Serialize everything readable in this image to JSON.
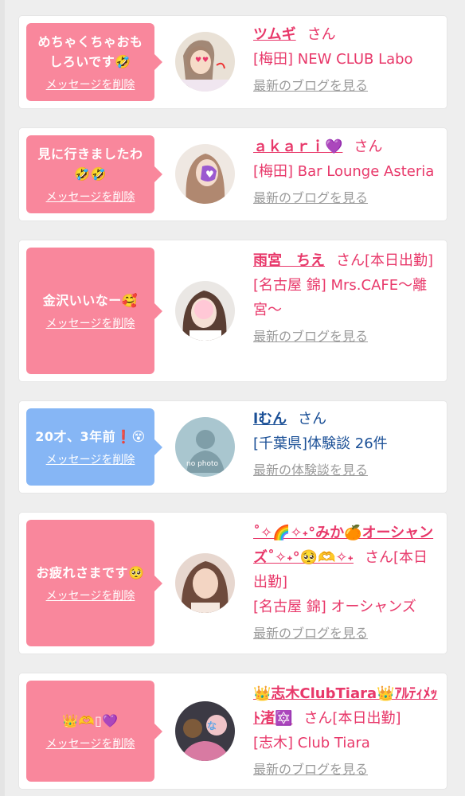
{
  "delete_label": "メッセージを削除",
  "san_label": "さん",
  "entries": [
    {
      "message": "めちゃくちゃおもしろいです🤣",
      "name": "ツムギ",
      "tag": "",
      "shop": "[梅田] NEW CLUB Labo",
      "link": "最新のブログを見る"
    },
    {
      "message": "見に行きましたわ🤣🤣",
      "name": "ａｋａｒｉ💜",
      "tag": "",
      "shop": "[梅田] Bar Lounge Asteria",
      "link": "最新のブログを見る"
    },
    {
      "message": "金沢いいなー🥰",
      "name": "雨宮　ちえ",
      "tag": "[本日出勤]",
      "shop": "[名古屋 錦] Mrs.CAFE～離宮～",
      "link": "最新のブログを見る"
    },
    {
      "message": "20才、3年前❗😵",
      "name": "lむん",
      "tag": "",
      "shop": "[千葉県]体験談 26件",
      "link": "最新の体験談を見る",
      "avatar_text": "no photo"
    },
    {
      "message": "お疲れさまです🥺",
      "name": "˚✧🌈✧˖°みか🍊オーシャンズ˚✧˖°🥺🫶✧˖",
      "tag": "[本日出勤]",
      "shop": "[名古屋 錦] オーシャンズ",
      "link": "最新のブログを見る"
    },
    {
      "message": "👑🫶▯💜",
      "name": "👑志木ClubTiara👑ｱﾙﾃｨﾒｯﾄ渚🔯",
      "tag": "[本日出勤]",
      "shop": "[志木] Club Tiara",
      "link": "最新のブログを見る"
    }
  ]
}
